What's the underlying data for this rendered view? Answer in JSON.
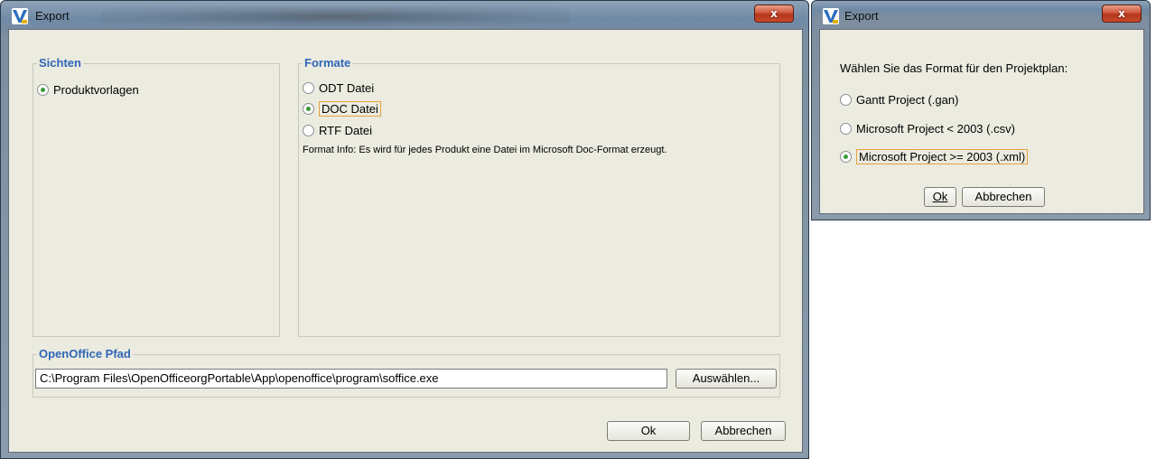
{
  "export_dialog": {
    "title": "Export",
    "close_label": "x",
    "views_group": {
      "title": "Sichten",
      "options": [
        {
          "label": "Produktvorlagen",
          "selected": true
        }
      ]
    },
    "formats_group": {
      "title": "Formate",
      "options": [
        {
          "label": "ODT Datei",
          "selected": false
        },
        {
          "label": "DOC Datei",
          "selected": true
        },
        {
          "label": "RTF Datei",
          "selected": false
        }
      ],
      "info": "Format Info: Es wird für jedes Produkt eine Datei im Microsoft Doc-Format erzeugt."
    },
    "openoffice_group": {
      "title": "OpenOffice Pfad",
      "path_value": "C:\\Program Files\\OpenOfficeorgPortable\\App\\openoffice\\program\\soffice.exe",
      "browse_label": "Auswählen..."
    },
    "ok_label": "Ok",
    "cancel_label": "Abbrechen"
  },
  "project_dialog": {
    "title": "Export",
    "close_label": "x",
    "prompt": "Wählen Sie das Format für den Projektplan:",
    "options": [
      {
        "label": "Gantt Project (.gan)",
        "selected": false
      },
      {
        "label": "Microsoft Project < 2003 (.csv)",
        "selected": false
      },
      {
        "label": "Microsoft Project >= 2003 (.xml)",
        "selected": true
      }
    ],
    "ok_label": "Ok",
    "cancel_label": "Abbrechen"
  },
  "colors": {
    "group_title": "#2e66b8",
    "dialog_background": "#ecebe0",
    "focus_border": "#e6a23c",
    "radio_selected": "#3c9a3c",
    "close_button": "#c94a2b"
  },
  "icons": [
    "app-v-icon",
    "close-icon",
    "radio-icon"
  ]
}
